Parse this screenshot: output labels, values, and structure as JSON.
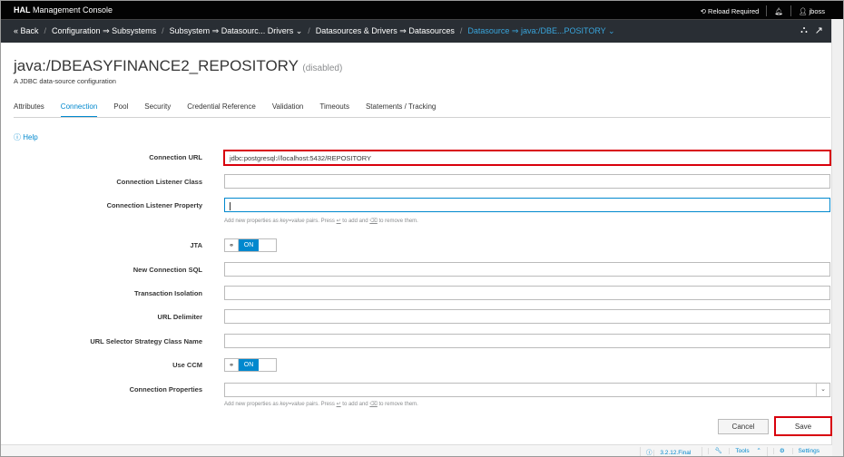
{
  "topbar": {
    "brand_bold": "HAL",
    "brand_rest": " Management Console",
    "reload": "Reload Required",
    "user": "jboss"
  },
  "breadcrumb": [
    {
      "text": "« Back",
      "active": false
    },
    {
      "text": "Configuration ⇒ Subsystems",
      "active": false
    },
    {
      "text": "Subsystem ⇒ Datasourc... Drivers ⌄",
      "active": false
    },
    {
      "text": "Datasources & Drivers ⇒ Datasources",
      "active": false
    },
    {
      "text": "Datasource ⇒ java:/DBE...POSITORY ⌄",
      "active": true
    }
  ],
  "header": {
    "title": "java:/DBEASYFINANCE2_REPOSITORY",
    "status": "(disabled)",
    "subtitle": "A JDBC data-source configuration"
  },
  "tabs": [
    "Attributes",
    "Connection",
    "Pool",
    "Security",
    "Credential Reference",
    "Validation",
    "Timeouts",
    "Statements / Tracking"
  ],
  "active_tab": "Connection",
  "help": "Help",
  "form": {
    "connection_url_label": "Connection URL",
    "connection_url_value": "jdbc:postgresql://localhost:5432/REPOSITORY",
    "listener_class_label": "Connection Listener Class",
    "listener_property_label": "Connection Listener Property",
    "hint_pre": "Add new properties as ",
    "hint_kv": "key=value",
    "hint_mid": " pairs. Press ",
    "hint_enter": "↵",
    "hint_mid2": " to add and ",
    "hint_del": "⌫",
    "hint_post": " to remove them.",
    "jta_label": "JTA",
    "jta_value": "ON",
    "new_sql_label": "New Connection SQL",
    "isolation_label": "Transaction Isolation",
    "url_delim_label": "URL Delimiter",
    "url_selector_label": "URL Selector Strategy Class Name",
    "use_ccm_label": "Use CCM",
    "use_ccm_value": "ON",
    "conn_props_label": "Connection Properties"
  },
  "buttons": {
    "cancel": "Cancel",
    "save": "Save"
  },
  "footer": {
    "version": "3.2.12.Final",
    "tools": "Tools",
    "settings": "Settings"
  },
  "colors": {
    "accent": "#0088ce",
    "highlight": "#d8000c",
    "topbar": "#030303",
    "crumbbar": "#292e34"
  }
}
